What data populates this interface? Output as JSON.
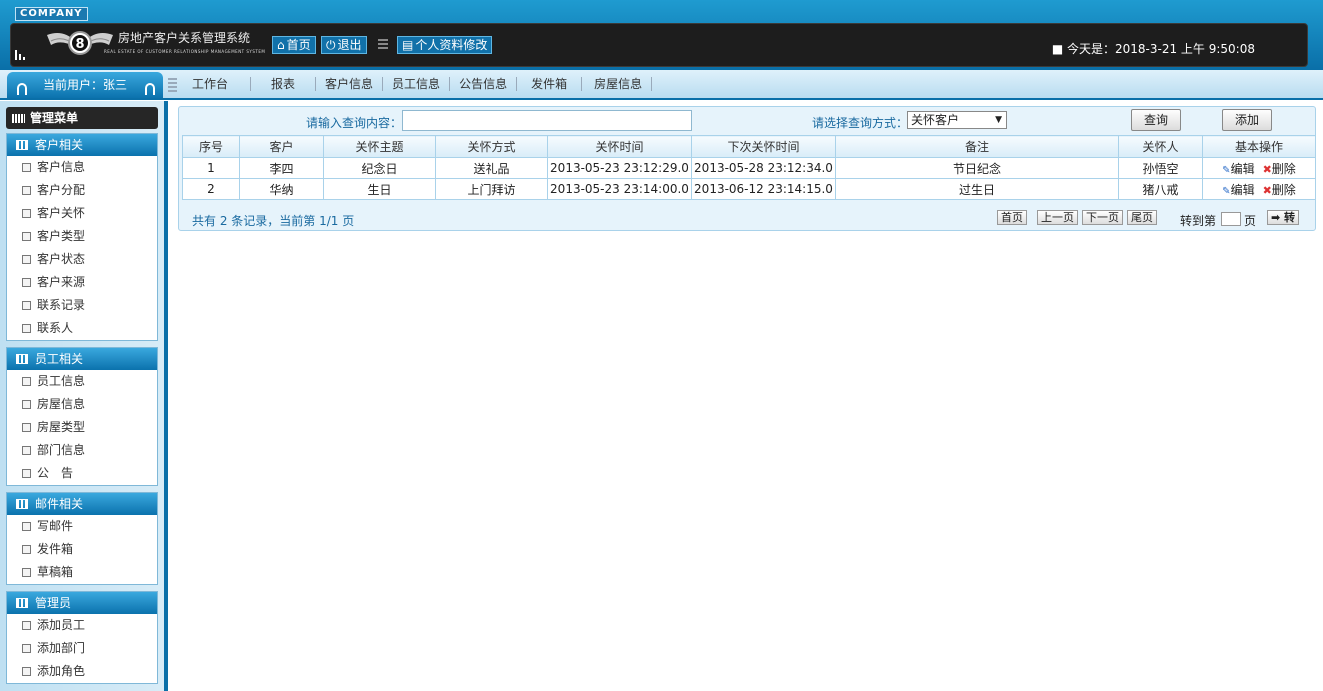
{
  "header": {
    "company": "COMPANY",
    "title": "房地产客户关系管理系统",
    "subtitle": "REAL ESTATE OF CUSTOMER RELATIONSHIP MANAGEMENT SYSTEM",
    "home_label": "首页",
    "logout_label": "退出",
    "profile_label": "个人资料修改",
    "datetime": "■ 今天是：2018-3-21 上午 9:50:08"
  },
  "nav": {
    "current_user": "当前用户：张三",
    "items": [
      "工作台",
      "报表",
      "客户信息",
      "员工信息",
      "公告信息",
      "发件箱",
      "房屋信息"
    ]
  },
  "sidebar": {
    "menu_title": "管理菜单",
    "groups": [
      {
        "title": "客户相关",
        "items": [
          "客户信息",
          "客户分配",
          "客户关怀",
          "客户类型",
          "客户状态",
          "客户来源",
          "联系记录",
          "联系人"
        ]
      },
      {
        "title": "员工相关",
        "items": [
          "员工信息",
          "房屋信息",
          "房屋类型",
          "部门信息",
          "公　告"
        ]
      },
      {
        "title": "邮件相关",
        "items": [
          "写邮件",
          "发件箱",
          "草稿箱"
        ]
      },
      {
        "title": "管理员",
        "items": [
          "添加员工",
          "添加部门",
          "添加角色"
        ]
      }
    ]
  },
  "search": {
    "label": "请输入查询内容：",
    "value": "",
    "mode_label": "请选择查询方式：",
    "mode_selected": "关怀客户",
    "query_label": "查询",
    "add_label": "添加"
  },
  "table": {
    "columns": [
      "序号",
      "客户",
      "关怀主题",
      "关怀方式",
      "关怀时间",
      "下次关怀时间",
      "备注",
      "关怀人",
      "基本操作"
    ],
    "rows": [
      [
        "1",
        "李四",
        "纪念日",
        "送礼品",
        "2013-05-23 23:12:29.0",
        "2013-05-28 23:12:34.0",
        "节日纪念",
        "孙悟空"
      ],
      [
        "2",
        "华纳",
        "生日",
        "上门拜访",
        "2013-05-23 23:14:00.0",
        "2013-06-12 23:14:15.0",
        "过生日",
        "猪八戒"
      ]
    ],
    "edit_label": "编辑",
    "delete_label": "删除"
  },
  "pager": {
    "info": "共有 2 条记录，当前第 1/1 页",
    "first": "首页",
    "prev": "上一页",
    "next": "下一页",
    "last": "尾页",
    "goto_label": "转到第",
    "goto_unit": "页",
    "goto_button": "➡ 转"
  }
}
